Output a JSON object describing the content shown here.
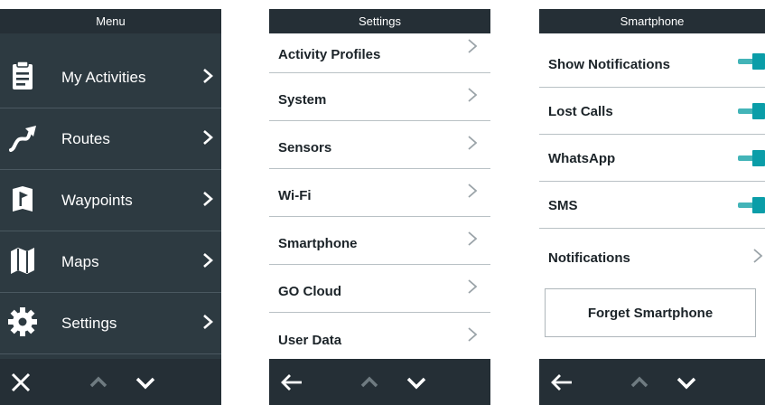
{
  "colors": {
    "menu_background": "#2d3a41",
    "title_bar": "#252f36",
    "toggle_on": "#0a9da8",
    "divider_light": "#b9c1c5"
  },
  "menu_screen": {
    "title": "Menu",
    "items": [
      {
        "label": "My Activities",
        "icon": "clipboard-icon"
      },
      {
        "label": "Routes",
        "icon": "route-icon"
      },
      {
        "label": "Waypoints",
        "icon": "waypoint-flag-icon"
      },
      {
        "label": "Maps",
        "icon": "map-icon"
      },
      {
        "label": "Settings",
        "icon": "gear-icon"
      }
    ],
    "bottom_bar": [
      "close-icon",
      "chevron-up-icon",
      "chevron-down-icon"
    ]
  },
  "settings_screen": {
    "title": "Settings",
    "items": [
      {
        "label": "Activity Profiles"
      },
      {
        "label": "System"
      },
      {
        "label": "Sensors"
      },
      {
        "label": "Wi-Fi"
      },
      {
        "label": "Smartphone"
      },
      {
        "label": "GO Cloud"
      },
      {
        "label": "User Data"
      }
    ],
    "bottom_bar": [
      "back-arrow-icon",
      "chevron-up-icon",
      "chevron-down-icon"
    ]
  },
  "smartphone_screen": {
    "title": "Smartphone",
    "toggles": [
      {
        "label": "Show Notifications",
        "on": true
      },
      {
        "label": "Lost Calls",
        "on": true
      },
      {
        "label": "WhatsApp",
        "on": true
      },
      {
        "label": "SMS",
        "on": true
      }
    ],
    "notifications_label": "Notifications",
    "forget_button": "Forget Smartphone",
    "bottom_bar": [
      "back-arrow-icon",
      "chevron-up-icon",
      "chevron-down-icon"
    ]
  }
}
